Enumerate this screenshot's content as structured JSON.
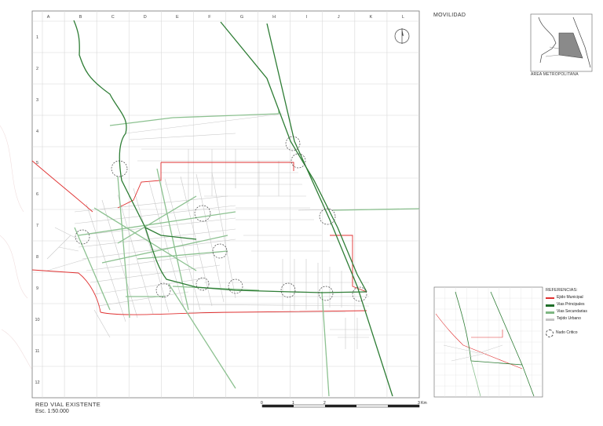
{
  "sheet_title": "MOVILIDAD",
  "inset_caption": "AREA METROPOLITANA",
  "map_title": "RED VIAL EXISTENTE",
  "map_scale": "Esc. 1:50.000",
  "grid": {
    "columns": [
      "A",
      "B",
      "C",
      "D",
      "E",
      "F",
      "G",
      "H",
      "I",
      "J",
      "K",
      "L"
    ],
    "rows": [
      "1",
      "2",
      "3",
      "4",
      "5",
      "6",
      "7",
      "8",
      "9",
      "10",
      "11",
      "12"
    ]
  },
  "legend": {
    "title": "REFERENCIAS:",
    "items": [
      {
        "label": "Ejido Municipal",
        "color": "#e03030"
      },
      {
        "label": "Vias Principales",
        "color": "#1f6e2a"
      },
      {
        "label": "Vias Secundarias",
        "color": "#7fb783"
      },
      {
        "label": "Tejido Urbano",
        "color": "#c4c4c4"
      }
    ],
    "node_label": "Nudo Critico"
  },
  "scale_bar": {
    "labels": [
      "0",
      "1",
      "2",
      "3 Km"
    ]
  },
  "colors": {
    "boundary": "#e03030",
    "primary_road": "#2e7d35",
    "secondary_road": "#8cc190",
    "urban_fabric": "#c9c9c9",
    "grid": "#d8d8d8",
    "frame": "#777777",
    "inset_fill": "#8a8a8a"
  },
  "icons": {
    "north_arrow": "north-arrow-icon"
  }
}
